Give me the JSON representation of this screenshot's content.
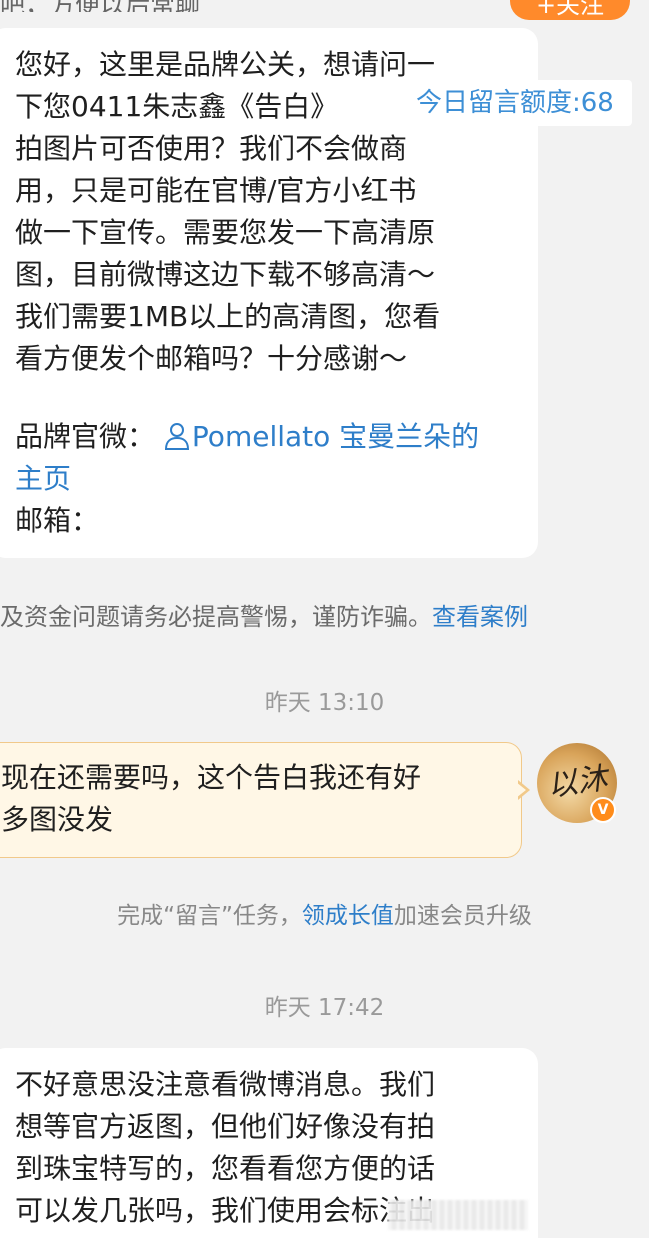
{
  "header": {
    "partial_text": "吧，方便以后常聊",
    "follow_label": "+关注"
  },
  "message1": {
    "lines": [
      "您好，这里是品牌公关，想请问一",
      "下您0411朱志鑫《告白》",
      "拍图片可否使用？我们不会做商",
      "用，只是可能在官博/官方小红书",
      "做一下宣传。需要您发一下高清原",
      "图，目前微博这边下载不够高清～",
      "我们需要1MB以上的高清图，您看",
      "看方便发个邮箱吗？十分感谢～"
    ],
    "quota_badge": "今日留言额度:68",
    "brand_label": "品牌官微：",
    "brand_link_line1": "Pomellato 宝曼兰朵的",
    "brand_link_line2": "主页",
    "email_label": "邮箱："
  },
  "notice": {
    "text": "及资金问题请务必提高警惕，谨防诈骗。",
    "link": "查看案例"
  },
  "time1": "昨天 13:10",
  "message2": {
    "lines": [
      "现在还需要吗，这个告白我还有好",
      "多图没发"
    ]
  },
  "avatar": {
    "signature": "以沐"
  },
  "task_notice": {
    "prefix": "完成“留言”任务，",
    "link": "领成长值",
    "suffix": "加速会员升级"
  },
  "time2": "昨天 17:42",
  "message3": {
    "lines": [
      "不好意思没注意看微博消息。我们",
      "想等官方返图，但他们好像没有拍",
      "到珠宝特写的，您看看您方便的话",
      "可以发几张吗，我们使用会标注出",
      "出处"
    ]
  },
  "icons": {
    "person": "person-icon",
    "verify": "verified-badge-icon"
  },
  "colors": {
    "link": "#2e7ec9",
    "follow": "#ff8a2b",
    "outgoing_bubble": "#fff7e6",
    "outgoing_border": "#f1c98a",
    "background": "#f2f2f2"
  }
}
